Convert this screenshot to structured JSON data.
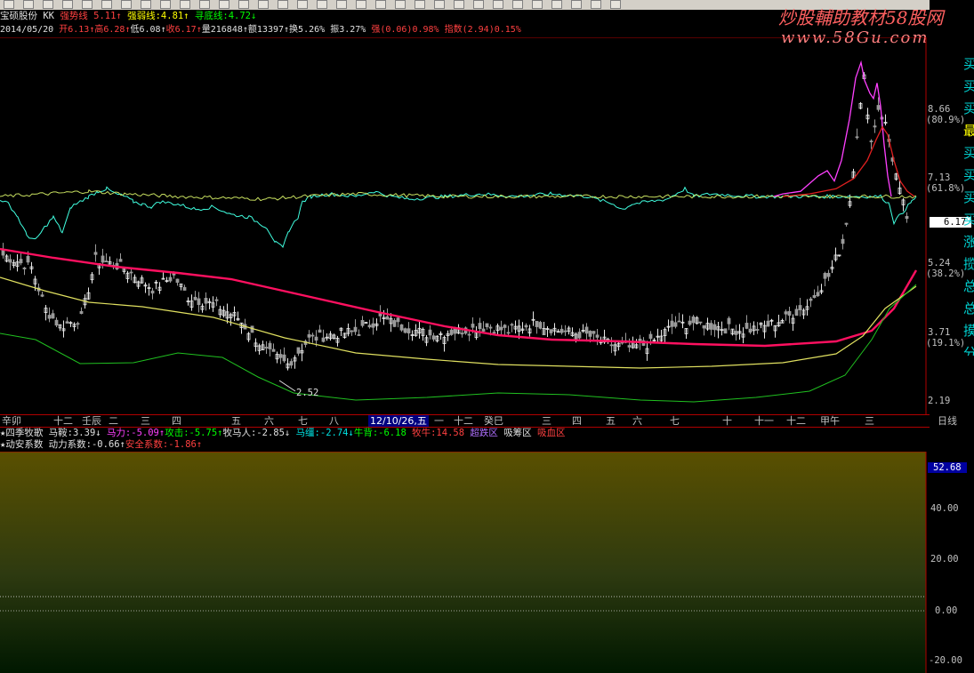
{
  "toolbar": {
    "icons": [
      "new-icon",
      "open-icon",
      "save-icon",
      "grid-icon",
      "grid-icon",
      "grid-icon",
      "grid-icon",
      "grid-icon",
      "grid-icon",
      "grid-icon",
      "grid-icon",
      "grid-icon",
      "grid-icon",
      "grid-icon",
      "grid-icon",
      "grid-icon",
      "grid-icon",
      "grid-icon",
      "grid-icon",
      "grid-icon",
      "cursor-icon",
      "line-icon",
      "bar-icon",
      "arrow-icon",
      "zoom-icon",
      "link-icon",
      "draw-icon",
      "text-icon",
      "copy-icon",
      "rect-icon",
      "delete-icon",
      "color-icon"
    ]
  },
  "watermark": {
    "title": "炒股輔助教材58股网",
    "url": "www.58Gu.com"
  },
  "header": {
    "stock_name": "宝硕股份",
    "indicator": "KK",
    "items": [
      {
        "label": "强势线",
        "value": "5.11",
        "arrow": "↑"
      },
      {
        "label": "强弱线:",
        "value": "4.81",
        "arrow": "↑"
      },
      {
        "label": "寻底线:",
        "value": "4.72",
        "arrow": "↓"
      }
    ]
  },
  "quote": {
    "date": "2014/05/20",
    "open_label": "开",
    "open": "6.13",
    "high_label": "高",
    "high": "6.28",
    "low_label": "低",
    "low": "6.08",
    "close_label": "收",
    "close": "6.17",
    "volume_label": "量",
    "volume": "216848",
    "amount_label": "额",
    "amount": "13397",
    "turnover_label": "换",
    "turnover": "5.26%",
    "amplitude_label": "振",
    "amplitude": "3.27%",
    "strength_label": "强",
    "strength": "(0.06)0.98%",
    "index_label": "指数",
    "index": "(2.94)0.15%"
  },
  "main_axis": {
    "labels": [
      {
        "price": "8.66",
        "pct": "(80.9%)"
      },
      {
        "price": "7.13",
        "pct": "(61.8%)"
      },
      {
        "price": "5.24",
        "pct": "(38.2%)"
      },
      {
        "price": "3.71",
        "pct": "(19.1%)"
      },
      {
        "price": "2.19",
        "pct": ""
      }
    ],
    "current_price": "6.17",
    "low_marker": "2.52"
  },
  "right_strip": {
    "chars": [
      "买",
      "买",
      "买",
      "最",
      "买",
      "买",
      "买",
      "买",
      "涨",
      "揽",
      "总",
      "总",
      "摸",
      "分",
      "分"
    ]
  },
  "date_bar": {
    "labels": [
      "辛卯",
      "十二",
      "壬辰",
      "二",
      "三",
      "四",
      "五",
      "六",
      "七",
      "八",
      "12/10/26,五",
      "一",
      "十二",
      "癸巳",
      "三",
      "四",
      "五",
      "六",
      "七",
      "十",
      "十一",
      "十二",
      "甲午",
      "三"
    ],
    "period": "日线"
  },
  "sub_header1": {
    "title": "★四季牧歌",
    "items": [
      {
        "label": "马鞍:",
        "value": "3.39",
        "arrow": "↓"
      },
      {
        "label": "马力:",
        "value": "-5.09",
        "arrow": "↑"
      },
      {
        "label": "攻击:",
        "value": "-5.75",
        "arrow": "↑"
      },
      {
        "label": "牧马人:",
        "value": "-2.85",
        "arrow": "↓"
      },
      {
        "label": "马缰:",
        "value": "-2.74",
        "arrow": "↓"
      },
      {
        "label": "牛背:",
        "value": "-6.18",
        "arrow": ""
      },
      {
        "label": "牧牛:",
        "value": "14.58",
        "arrow": ""
      }
    ],
    "zones": [
      "超跌区",
      "吸筹区",
      "吸血区"
    ]
  },
  "sub_header2": {
    "title": "★动安系数",
    "items": [
      {
        "label": "动力系数:",
        "value": "-0.66",
        "arrow": "↑"
      },
      {
        "label": "安全系数:",
        "value": "-1.86",
        "arrow": "↑"
      }
    ]
  },
  "sub_axis": {
    "labels": [
      "40.00",
      "20.00",
      "0.00",
      "-20.00"
    ],
    "current_value": "52.68"
  },
  "colors": {
    "ma_red": "#ff1060",
    "ma_yellow": "#e0e060",
    "ma_green": "#20c020",
    "candle": "#c8c8c8",
    "osc_cyan": "#40ffe0",
    "osc_pink": "#ff40ff",
    "osc_red": "#e02020"
  }
}
